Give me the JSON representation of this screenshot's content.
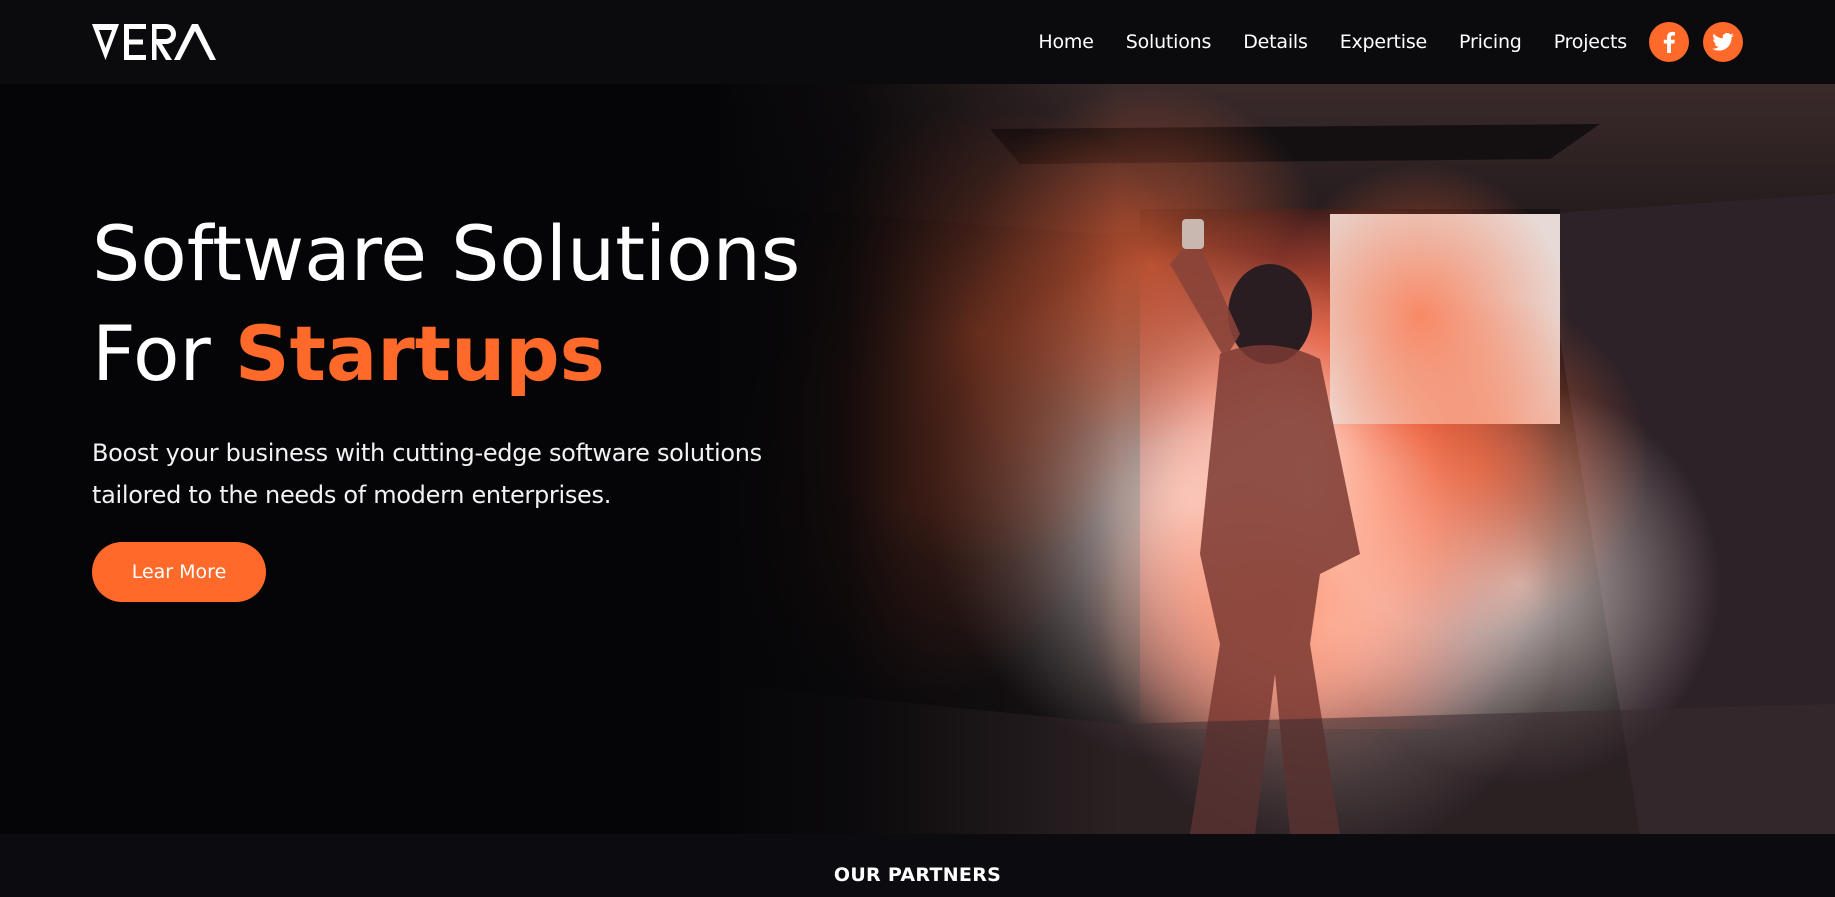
{
  "brand": {
    "name": "VERA",
    "accent_color": "#ff6a2b"
  },
  "nav": {
    "links": [
      {
        "label": "Home"
      },
      {
        "label": "Solutions"
      },
      {
        "label": "Details"
      },
      {
        "label": "Expertise"
      },
      {
        "label": "Pricing"
      },
      {
        "label": "Projects"
      }
    ],
    "social": [
      {
        "icon": "facebook-icon",
        "label": "f"
      },
      {
        "icon": "twitter-icon"
      }
    ]
  },
  "hero": {
    "title_line1": "Software Solutions",
    "title_line2_prefix": "For ",
    "title_line2_accent": "Startups",
    "subtitle": "Boost your business with cutting-edge software solutions tailored to the needs of modern enterprises.",
    "cta_label": "Lear More",
    "image": "smoke-flare-photo"
  },
  "partners": {
    "label": "OUR PARTNERS"
  }
}
